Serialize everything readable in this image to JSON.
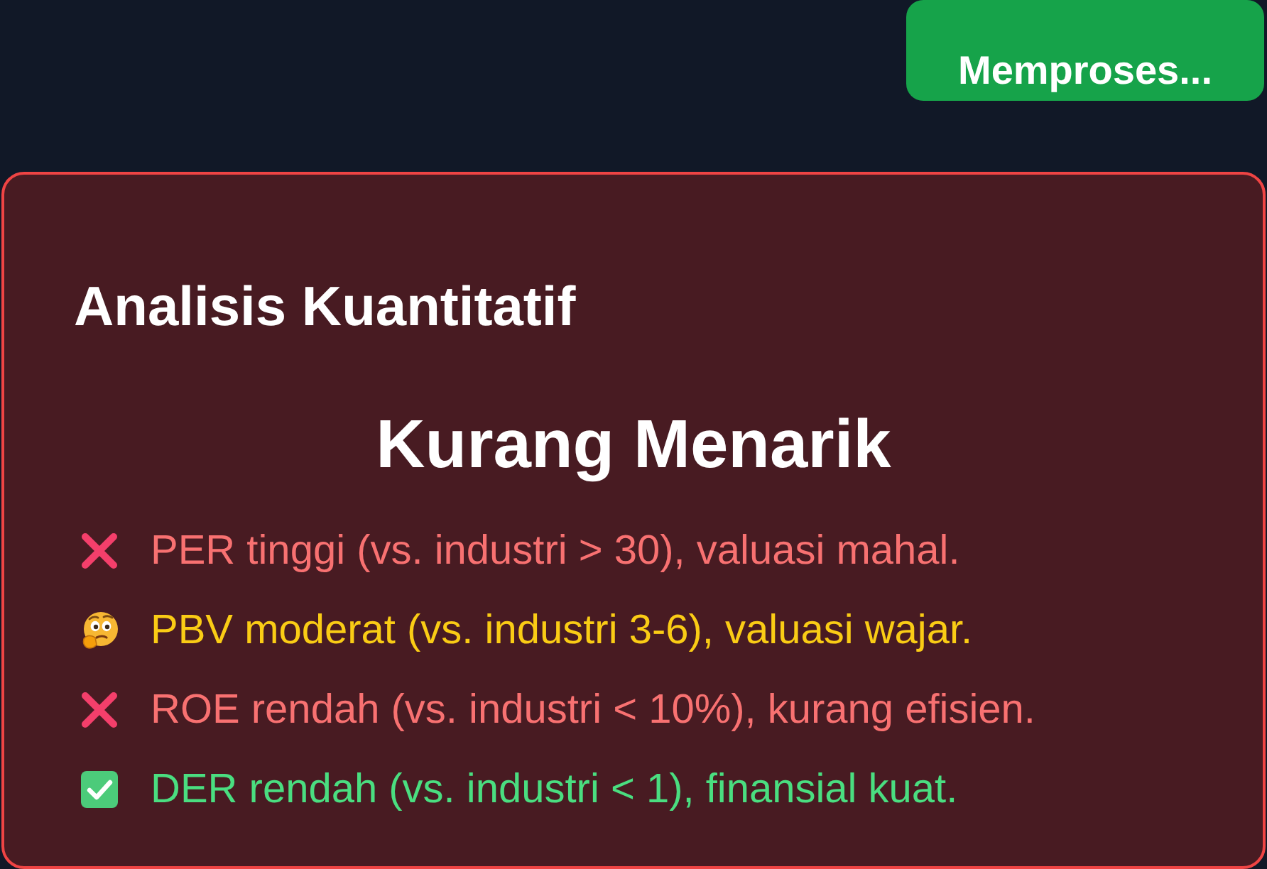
{
  "button": {
    "label": "Memproses..."
  },
  "card": {
    "title": "Analisis Kuantitatif",
    "verdict": "Kurang Menarik",
    "items": [
      {
        "kind": "negative",
        "text": "PER tinggi (vs. industri > 30), valuasi mahal."
      },
      {
        "kind": "neutral",
        "text": "PBV moderat (vs. industri 3-6), valuasi wajar."
      },
      {
        "kind": "negative",
        "text": "ROE rendah (vs. industri < 10%), kurang efisien."
      },
      {
        "kind": "positive",
        "text": "DER rendah (vs. industri < 1), finansial kuat."
      }
    ]
  }
}
